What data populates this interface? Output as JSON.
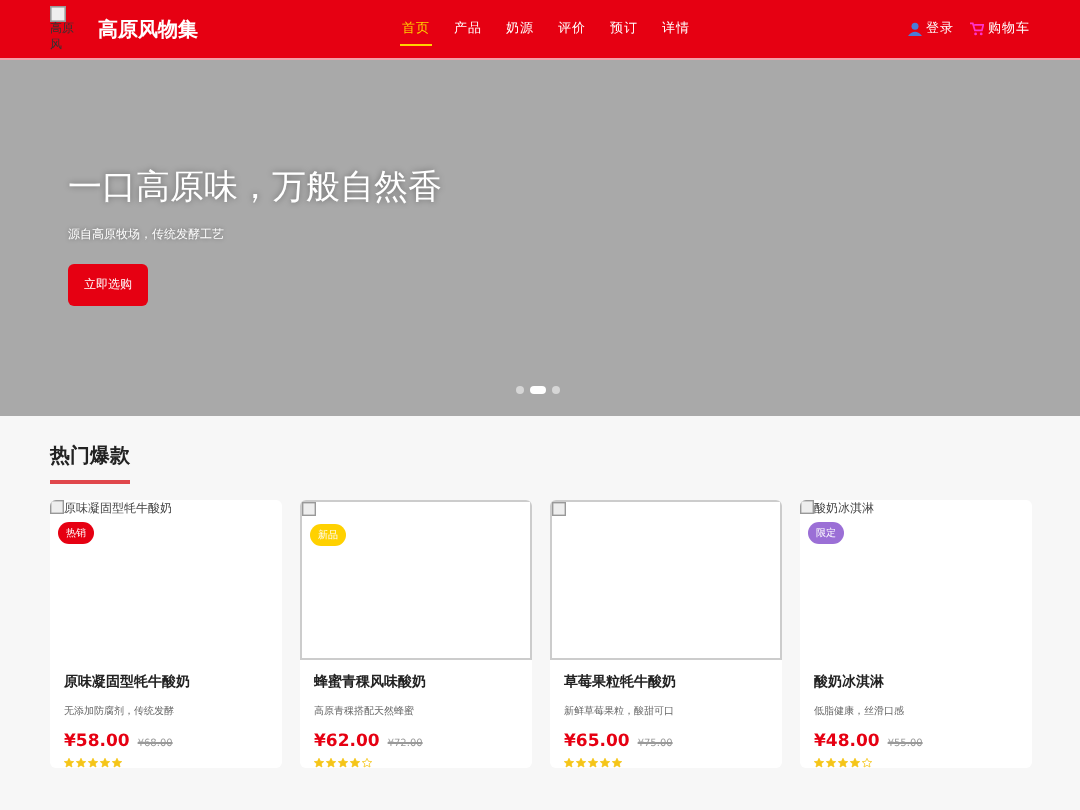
{
  "header": {
    "logo_alt": "高原风",
    "brand": "高原风物集",
    "nav": [
      {
        "label": "首页",
        "selected": true
      },
      {
        "label": "产品",
        "selected": false
      },
      {
        "label": "奶源",
        "selected": false
      },
      {
        "label": "评价",
        "selected": false
      },
      {
        "label": "预订",
        "selected": false
      },
      {
        "label": "详情",
        "selected": false
      }
    ],
    "login": "登录",
    "cart": "购物车"
  },
  "hero": {
    "title": "一口高原味，万般自然香",
    "subtitle": "源自高原牧场，传统发酵工艺",
    "button": "立即选购",
    "dots": [
      {
        "selected": false
      },
      {
        "selected": true
      },
      {
        "selected": false
      }
    ]
  },
  "section": {
    "title": "热门爆款"
  },
  "products": [
    {
      "image_alt": "原味凝固型牦牛酸奶",
      "badge": "热销",
      "color": "#e60012",
      "name": "原味凝固型牦牛酸奶",
      "desc": "无添加防腐剂，传统发酵",
      "price": "¥58.00",
      "old_price": "¥68.00",
      "stars": 5
    },
    {
      "badge": "新品",
      "color": "#ffd100",
      "name": "蜂蜜青稞风味酸奶",
      "desc": "高原青稞搭配天然蜂蜜",
      "price": "¥62.00",
      "old_price": "¥72.00",
      "stars": 4
    },
    {
      "name": "草莓果粒牦牛酸奶",
      "desc": "新鲜草莓果粒，酸甜可口",
      "price": "¥65.00",
      "old_price": "¥75.00",
      "stars": 5
    },
    {
      "image_alt": "酸奶冰淇淋",
      "badge": "限定",
      "color": "#9b6fd6",
      "name": "酸奶冰淇淋",
      "desc": "低脂健康，丝滑口感",
      "price": "¥48.00",
      "old_price": "¥55.00",
      "stars": 4
    }
  ]
}
